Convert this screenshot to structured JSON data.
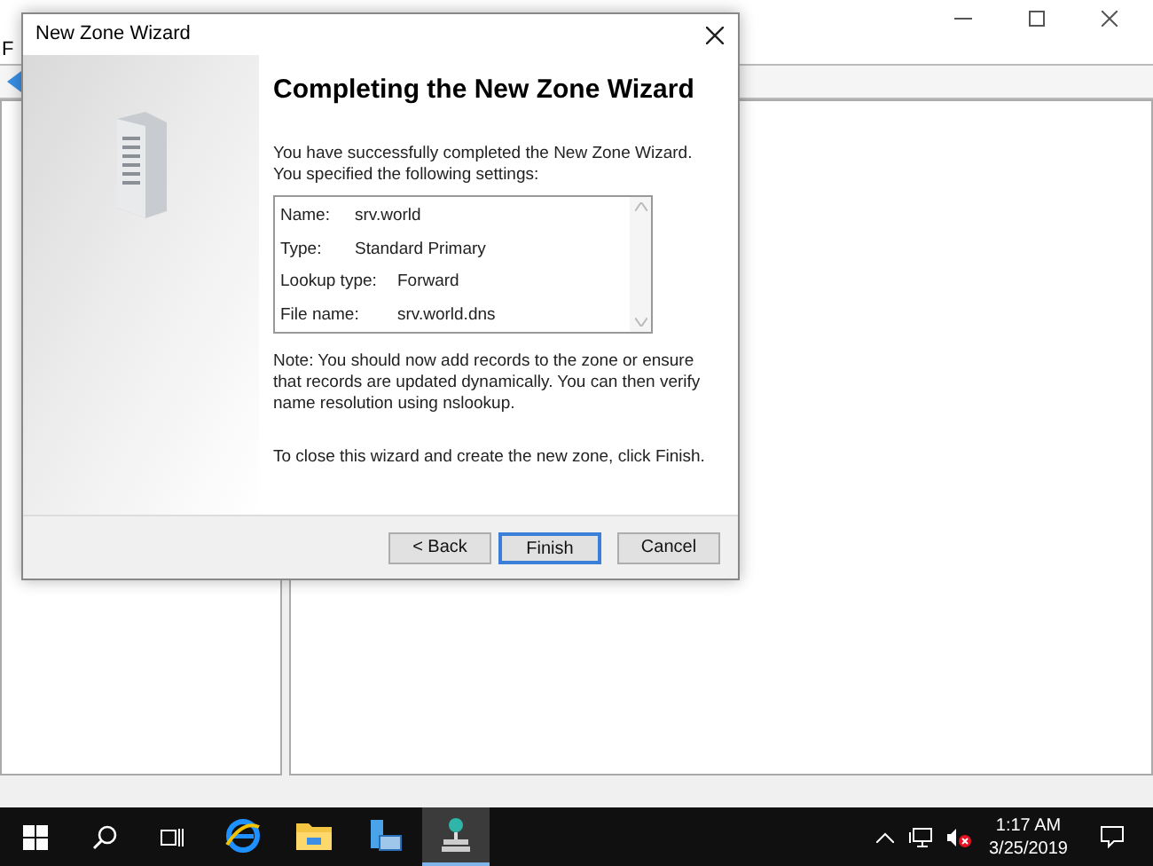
{
  "background_window": {
    "menu": [
      "F"
    ]
  },
  "dialog": {
    "title": "New Zone Wizard",
    "heading": "Completing the New Zone Wizard",
    "intro": "You have successfully completed the New Zone Wizard. You specified the following settings:",
    "settings": [
      {
        "label": "Name:",
        "value": "srv.world"
      },
      {
        "label": "Type:",
        "value": "Standard Primary"
      },
      {
        "label": "Lookup type:",
        "value": "Forward"
      },
      {
        "label": "File name:",
        "value": "srv.world.dns"
      }
    ],
    "note": "Note: You should now add records to the zone or ensure that records are updated dynamically. You can then verify name resolution using nslookup.",
    "instruction": "To close this wizard and create the new zone, click Finish.",
    "buttons": [
      {
        "label": "< Back",
        "selected": false
      },
      {
        "label": "Finish",
        "selected": true
      },
      {
        "label": "Cancel",
        "selected": false
      }
    ]
  },
  "taskbar": {
    "apps": [
      {
        "kind": "ie",
        "active": false
      },
      {
        "kind": "folder",
        "active": false
      },
      {
        "kind": "server",
        "active": false
      },
      {
        "kind": "dns",
        "active": true
      }
    ],
    "clock": {
      "time": "1:17 AM",
      "date": "3/25/2019"
    }
  }
}
